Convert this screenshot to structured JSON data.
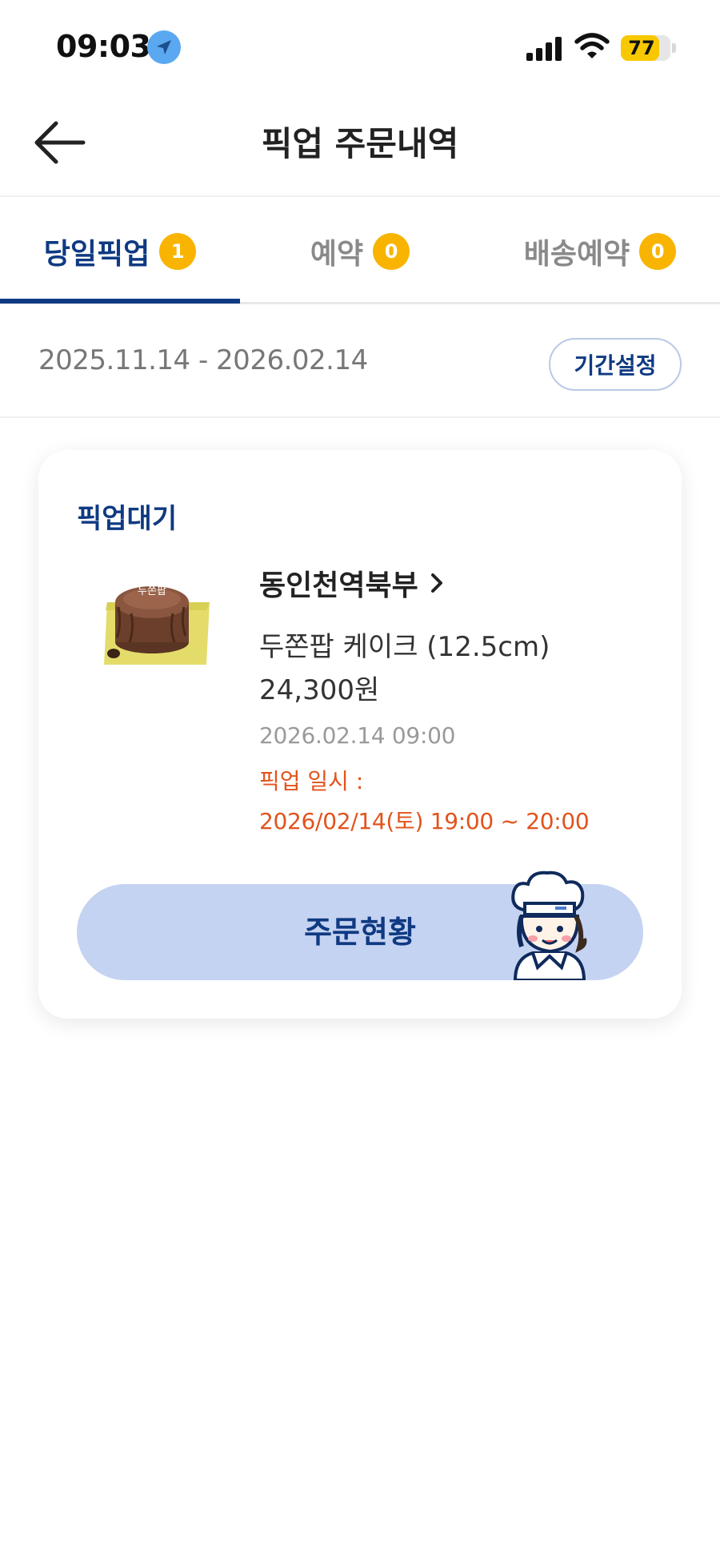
{
  "status_bar": {
    "time": "09:03",
    "battery": "77",
    "battery_level": 0.77,
    "location_icon": "location-arrow-icon",
    "signal_icon": "cellular-signal-icon",
    "wifi_icon": "wifi-icon"
  },
  "header": {
    "title": "픽업 주문내역",
    "back_icon": "back-arrow-icon"
  },
  "tabs": [
    {
      "label": "당일픽업",
      "count": "1",
      "active": true
    },
    {
      "label": "예약",
      "count": "0",
      "active": false
    },
    {
      "label": "배송예약",
      "count": "0",
      "active": false
    }
  ],
  "date_filter": {
    "range": "2025.11.14 - 2026.02.14",
    "button": "기간설정"
  },
  "order": {
    "status": "픽업대기",
    "store": "동인천역북부",
    "product": "두쫀팝 케이크 (12.5cm)",
    "price": "24,300원",
    "ordered_at": "2026.02.14 09:00",
    "pickup_label": "픽업 일시 :",
    "pickup_time": "2026/02/14(토) 19:00 ~ 20:00",
    "action_button": "주문현황",
    "cake_label": "두쫀팝"
  },
  "colors": {
    "brand_navy": "#0f3a82",
    "badge_yellow": "#f8b400",
    "pickup_orange": "#e2531c",
    "button_bg": "#c5d3f2"
  }
}
